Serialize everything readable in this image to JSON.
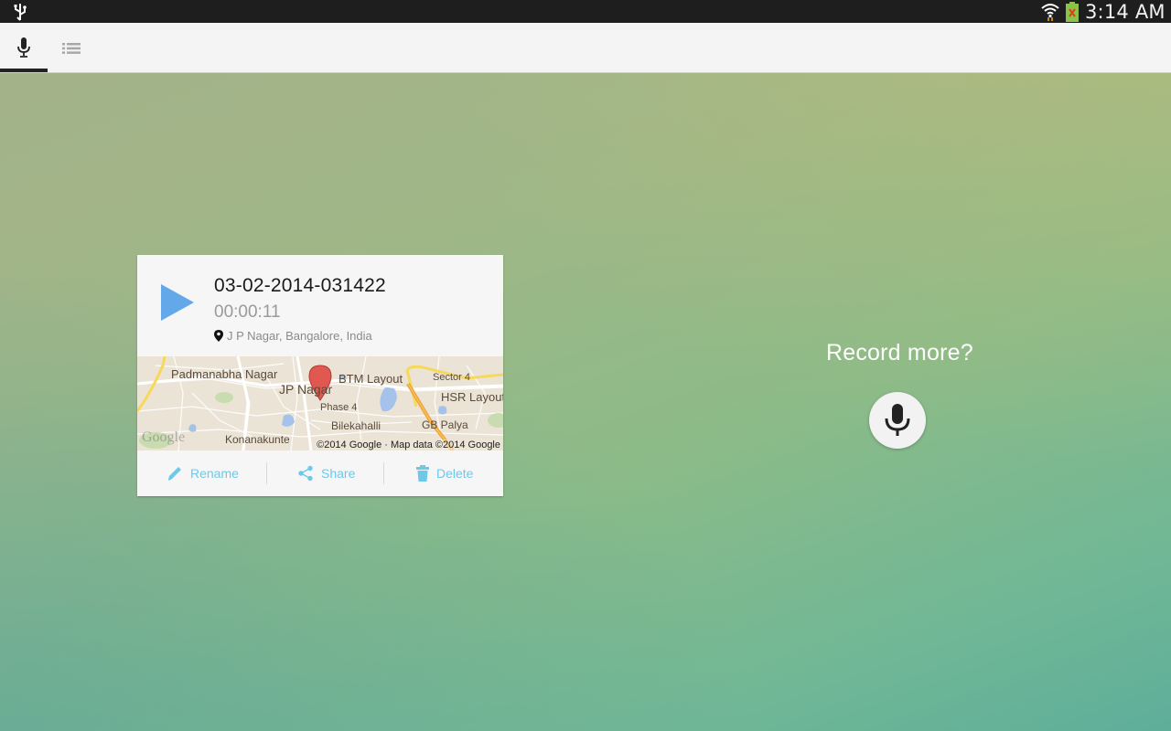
{
  "status_bar": {
    "time": "3:14 AM",
    "icons": [
      "usb-icon",
      "wifi-icon",
      "battery-icon"
    ]
  },
  "tabs": [
    {
      "name": "record",
      "icon": "microphone-icon",
      "selected": true
    },
    {
      "name": "recordings-list",
      "icon": "list-icon",
      "selected": false
    }
  ],
  "recording_card": {
    "title": "03-02-2014-031422",
    "duration": "00:00:11",
    "location": "J P Nagar, Bangalore, India",
    "map": {
      "labels": [
        "Padmanabha Nagar",
        "BTM Layout",
        "Sector 4",
        "JP Nagar",
        "HSR Layout",
        "Phase 4",
        "Bilekahalli",
        "GB Palya",
        "Konanakunte"
      ],
      "logo": "Google",
      "copyright": "©2014 Google · Map data ©2014 Google"
    },
    "actions": {
      "rename": "Rename",
      "share": "Share",
      "delete": "Delete"
    }
  },
  "record_more": {
    "prompt": "Record more?"
  },
  "colors": {
    "accent": "#6ec8e8",
    "play": "#63a8e8",
    "status_bar": "#1e1e1e",
    "tab_bar": "#f3f4f3"
  }
}
